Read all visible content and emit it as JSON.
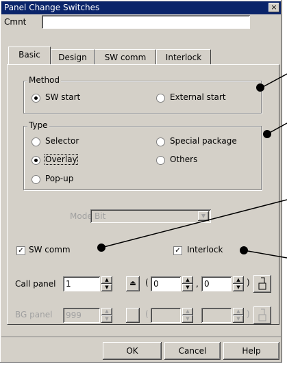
{
  "window": {
    "title": "Panel Change Switches",
    "close_glyph": "×"
  },
  "comment": {
    "label": "Cmnt",
    "value": ""
  },
  "tabs": [
    {
      "label": "Basic",
      "active": true
    },
    {
      "label": "Design",
      "active": false
    },
    {
      "label": "SW comm",
      "active": false
    },
    {
      "label": "Interlock",
      "active": false
    }
  ],
  "method": {
    "label": "Method",
    "options": [
      {
        "label": "SW start",
        "selected": true
      },
      {
        "label": "External start",
        "selected": false
      }
    ]
  },
  "type": {
    "label": "Type",
    "options": [
      {
        "label": "Selector",
        "selected": false
      },
      {
        "label": "Special package",
        "selected": false
      },
      {
        "label": "Overlay",
        "selected": true
      },
      {
        "label": "Others",
        "selected": false
      },
      {
        "label": "Pop-up",
        "selected": false
      }
    ]
  },
  "mode": {
    "label": "Mode",
    "value": "Bit",
    "enabled": false
  },
  "sw_comm": {
    "label": "SW comm",
    "checked": true
  },
  "interlock": {
    "label": "Interlock",
    "checked": true
  },
  "call_panel": {
    "label": "Call panel",
    "value": "1",
    "x": "0",
    "y": "0",
    "enabled": true
  },
  "bg_panel": {
    "label": "BG panel",
    "value": "999",
    "enabled": false
  },
  "punctuation": {
    "open": "(",
    "comma": ",",
    "close": ")"
  },
  "buttons": {
    "ok": "OK",
    "cancel": "Cancel",
    "help": "Help"
  }
}
